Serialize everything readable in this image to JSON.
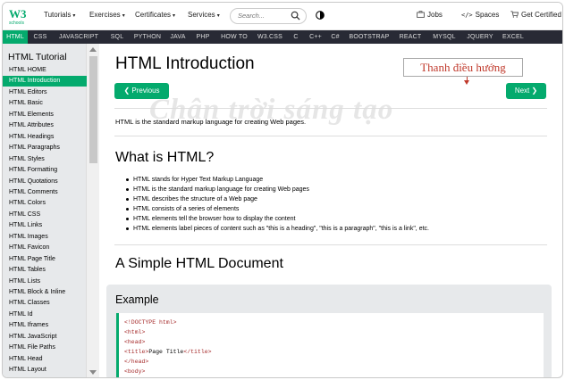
{
  "logo": {
    "text": "W3",
    "sub": "schools"
  },
  "topnav": [
    {
      "label": "Tutorials"
    },
    {
      "label": "Exercises"
    },
    {
      "label": "Certificates"
    },
    {
      "label": "Services"
    }
  ],
  "search": {
    "placeholder": "Search..."
  },
  "rightnav": {
    "jobs": "Jobs",
    "spaces": "Spaces",
    "certified": "Get Certified"
  },
  "langbar": [
    "HTML",
    "CSS",
    "JAVASCRIPT",
    "SQL",
    "PYTHON",
    "JAVA",
    "PHP",
    "HOW TO",
    "W3.CSS",
    "C",
    "C++",
    "C#",
    "BOOTSTRAP",
    "REACT",
    "MYSQL",
    "JQUERY",
    "EXCEL"
  ],
  "sidebar": {
    "title": "HTML Tutorial",
    "items": [
      "HTML HOME",
      "HTML Introduction",
      "HTML Editors",
      "HTML Basic",
      "HTML Elements",
      "HTML Attributes",
      "HTML Headings",
      "HTML Paragraphs",
      "HTML Styles",
      "HTML Formatting",
      "HTML Quotations",
      "HTML Comments",
      "HTML Colors",
      "HTML CSS",
      "HTML Links",
      "HTML Images",
      "HTML Favicon",
      "HTML Page Title",
      "HTML Tables",
      "HTML Lists",
      "HTML Block & Inline",
      "HTML Classes",
      "HTML Id",
      "HTML Iframes",
      "HTML JavaScript",
      "HTML File Paths",
      "HTML Head",
      "HTML Layout"
    ],
    "active_index": 1
  },
  "main": {
    "title": "HTML Introduction",
    "annotation": "Thanh điều hướng",
    "prev": "❮ Previous",
    "next": "Next ❯",
    "intro": "HTML is the standard markup language for creating Web pages.",
    "watermark": "Chân trời sáng tạo",
    "what_heading": "What is HTML?",
    "bullets": [
      "HTML stands for Hyper Text Markup Language",
      "HTML is the standard markup language for creating Web pages",
      "HTML describes the structure of a Web page",
      "HTML consists of a series of elements",
      "HTML elements tell the browser how to display the content",
      "HTML elements label pieces of content such as \"this is a heading\", \"this is a paragraph\", \"this is a link\", etc."
    ],
    "simple_heading": "A Simple HTML Document",
    "example_heading": "Example",
    "code": [
      {
        "tag": "<!DOCTYPE html>",
        "text": "",
        "close": ""
      },
      {
        "tag": "<html>",
        "text": "",
        "close": ""
      },
      {
        "tag": "<head>",
        "text": "",
        "close": ""
      },
      {
        "tag": "<title>",
        "text": "Page Title",
        "close": "</title>"
      },
      {
        "tag": "</head>",
        "text": "",
        "close": ""
      },
      {
        "tag": "<body>",
        "text": "",
        "close": ""
      }
    ]
  },
  "colors": {
    "accent": "#04aa6d",
    "langbar_bg": "#282a35",
    "sidebar_bg": "#e7e9eb",
    "annotation": "#c0392b"
  }
}
